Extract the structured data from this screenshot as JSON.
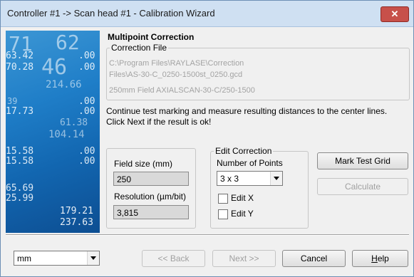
{
  "window": {
    "title": "Controller #1 -> Scan head #1 - Calibration Wizard",
    "close_glyph": "✕"
  },
  "side_image": {
    "numbers": [
      "71",
      "62",
      "63.42",
      ".00",
      "70.28",
      "46",
      ".00",
      "214.66",
      "39",
      ".00",
      "17.73",
      ".00",
      "61.38",
      "104.14",
      "15.58",
      ".00",
      "15.58",
      ".00",
      "65.69",
      "25.99",
      "179.21",
      "237.63"
    ]
  },
  "page": {
    "heading": "Multipoint Correction",
    "correction_file": {
      "legend": "Correction File",
      "path_line1": "C:\\Program Files\\RAYLASE\\Correction",
      "path_line2": "Files\\AS-30-C_0250-1500st_0250.gcd",
      "description": "250mm Field AXIALSCAN-30-C/250-1500"
    },
    "instruction_line1": "Continue test marking and measure resulting distances to the center lines.",
    "instruction_line2": "Click Next if the result is ok!",
    "field_size": {
      "label": "Field size (mm)",
      "value": "250"
    },
    "resolution": {
      "label": "Resolution (µm/bit)",
      "value": "3,815"
    },
    "edit_correction": {
      "legend": "Edit Correction",
      "points_label": "Number of Points",
      "points_value": "3 x 3",
      "edit_x": "Edit X",
      "edit_y": "Edit Y",
      "edit_x_checked": false,
      "edit_y_checked": false
    },
    "buttons": {
      "mark_test_grid": "Mark Test Grid",
      "calculate": "Calculate"
    }
  },
  "footer": {
    "unit_value": "mm",
    "back": "<< Back",
    "next": "Next >>",
    "cancel": "Cancel",
    "help_accel": "H",
    "help_rest": "elp"
  },
  "colors": {
    "title_bar": "#cfe0f2",
    "close_button": "#c7504a",
    "dialog_bg": "#f0f0f0",
    "image_blue": "#1f7ec8"
  }
}
